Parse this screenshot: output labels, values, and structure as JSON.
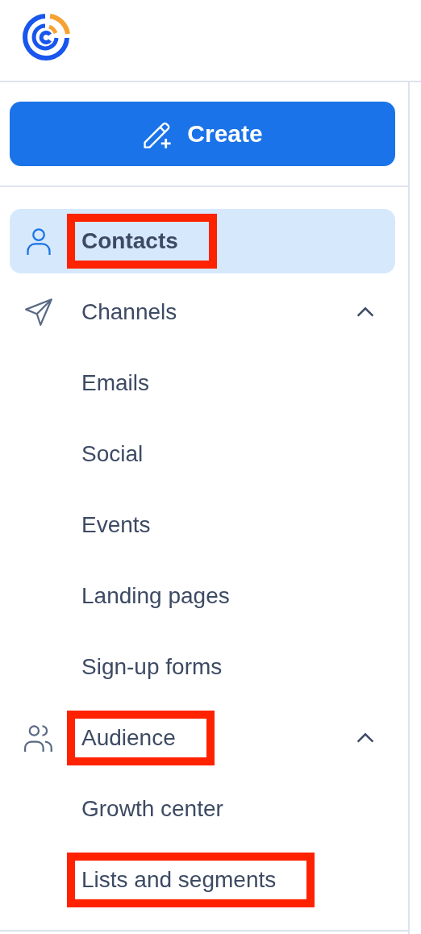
{
  "create_button": {
    "label": "Create"
  },
  "nav": [
    {
      "label": "Contacts",
      "selected": true,
      "highlighted": true
    },
    {
      "label": "Channels",
      "selected": false,
      "highlighted": false,
      "expanded": true,
      "children": [
        {
          "label": "Emails",
          "selected": false,
          "highlighted": false
        },
        {
          "label": "Social",
          "selected": false,
          "highlighted": false
        },
        {
          "label": "Events",
          "selected": false,
          "highlighted": false
        },
        {
          "label": "Landing pages",
          "selected": false,
          "highlighted": false
        },
        {
          "label": "Sign-up forms",
          "selected": false,
          "highlighted": false
        }
      ]
    },
    {
      "label": "Audience",
      "selected": false,
      "highlighted": true,
      "expanded": true,
      "children": [
        {
          "label": "Growth center",
          "selected": false,
          "highlighted": false
        },
        {
          "label": "Lists and segments",
          "selected": false,
          "highlighted": true
        }
      ]
    }
  ]
}
